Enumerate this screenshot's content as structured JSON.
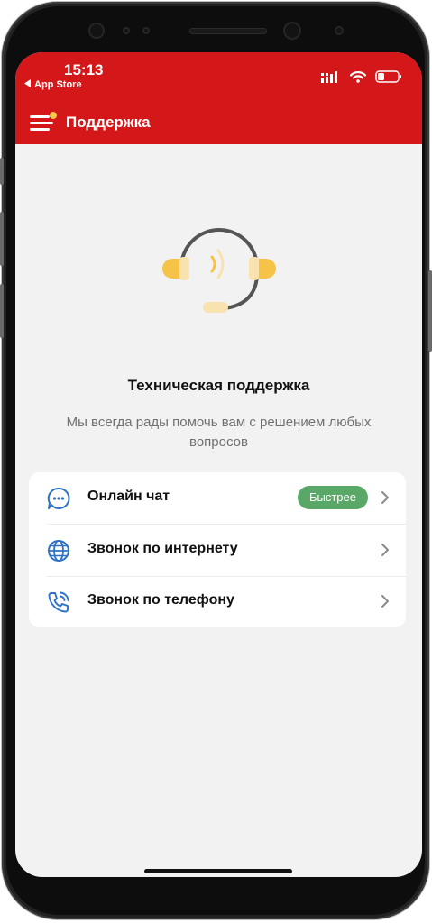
{
  "status_bar": {
    "time": "15:13",
    "back_app": "App Store",
    "back_icon": "back-triangle-icon",
    "signal_icon": "signal-icon",
    "wifi_icon": "wifi-icon",
    "battery_icon": "battery-icon"
  },
  "header": {
    "title": "Поддержка",
    "menu_icon": "hamburger-menu-icon",
    "background": "#d41719",
    "notification_dot_color": "#f6c54a"
  },
  "hero": {
    "icon": "headset-icon",
    "title": "Техническая поддержка",
    "description": "Мы всегда рады помочь вам с решением любых вопросов"
  },
  "options": [
    {
      "icon": "chat-bubble-icon",
      "label": "Онлайн чат",
      "badge": "Быстрее"
    },
    {
      "icon": "globe-icon",
      "label": "Звонок по интернету",
      "badge": ""
    },
    {
      "icon": "phone-call-icon",
      "label": "Звонок по телефону",
      "badge": ""
    }
  ],
  "colors": {
    "accent_blue": "#2c72c7",
    "badge_green": "#5aa868",
    "headset_yellow": "#f5c348",
    "background": "#f2f2f2"
  }
}
